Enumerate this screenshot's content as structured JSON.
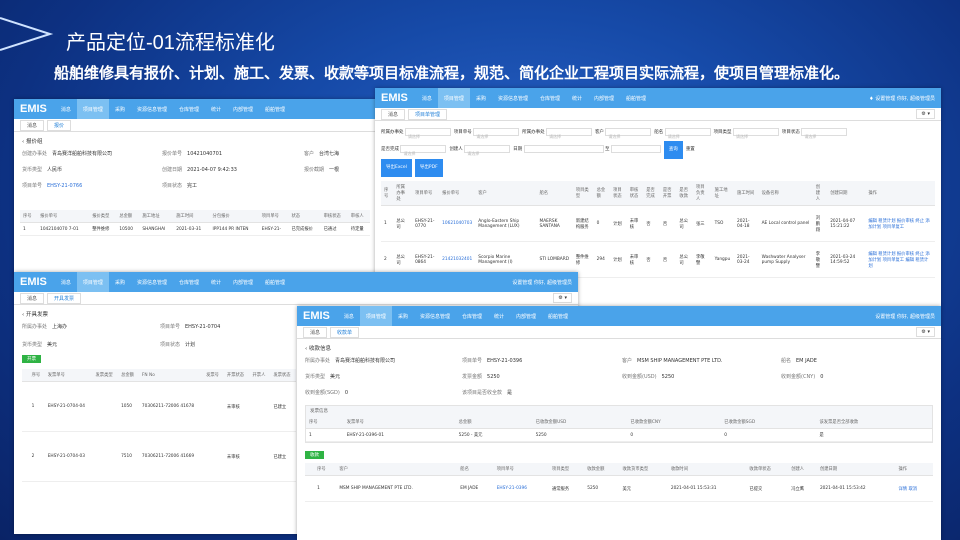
{
  "slide": {
    "title": "产品定位-01流程标准化",
    "subtitle": "船舶维修具有报价、计划、施工、发票、收款等项目标准流程，规范、简化企业工程项目实际流程，使项目管理标准化。"
  },
  "app": {
    "logo": "EMIS",
    "menu": [
      "消息",
      "项目管理",
      "采购",
      "资源信息管理",
      "仓库管理",
      "统计",
      "内部管理",
      "船舶管理"
    ],
    "settings": "设置管理",
    "user": "你好, 超级管理员"
  },
  "win1": {
    "tabs": [
      "消息",
      "报价"
    ],
    "section": "报价组",
    "fields": [
      {
        "k": "创建办事处",
        "v": "青岛赛洋船舶科技有限公司"
      },
      {
        "k": "报价单号",
        "v": "10421040701"
      },
      {
        "k": "客户",
        "v": "台湾七海"
      },
      {
        "k": "货币类型",
        "v": "人民币"
      },
      {
        "k": "创建日期",
        "v": "2021-04-07 9:42:33"
      },
      {
        "k": "报价截期",
        "v": "一根"
      },
      {
        "k": "项目单号",
        "v": "EHSY-21-0766"
      },
      {
        "k": "项目状态",
        "v": "完工"
      }
    ],
    "headers": [
      "序号",
      "报价单号",
      "报价类型",
      "总金额",
      "施工地址",
      "施工时间",
      "分包报价",
      "项目单号",
      "状态",
      "审核状态",
      "审核人"
    ],
    "row": [
      "1",
      "1042104070 7-01",
      "整件维修",
      "10500",
      "SHANGHAI",
      "2021-03-31",
      "IPP144 PR INTEN",
      "EHSY-21-",
      "已完成报价",
      "已通过",
      "待定量"
    ]
  },
  "win2": {
    "tabs": [
      "消息",
      "项目单管理"
    ],
    "labels": {
      "office": "所属办事处",
      "project_no": "项目单号",
      "office2": "所属办事处",
      "customer": "客户",
      "ship": "船名",
      "ptype": "项目类型",
      "pstatus": "项目状态",
      "done": "是否完成",
      "creator": "创建人",
      "date": "日期",
      "to": "至"
    },
    "placeholder": "请选择",
    "search": "查询",
    "reset": "重置",
    "export_excel": "导出Excel",
    "export_pdf": "导出PDF",
    "headers": [
      "序号",
      "所属办事处",
      "项目单号",
      "报价单号",
      "客户",
      "船名",
      "项目类型",
      "总金额",
      "项目状态",
      "审核状态",
      "是否完成",
      "是否开票",
      "是否收款",
      "项目负责人",
      "施工地址",
      "施工时间",
      "设备名称",
      "创建人",
      "创建日期",
      "操作"
    ],
    "rows": [
      [
        "1",
        "总公司",
        "EHSY-21-0770",
        "10621040703",
        "Anglo-Eastern Ship Management (LUX)",
        "MAERSK SANTANA",
        "新建结构服务",
        "0",
        "计划",
        "未审核",
        "否",
        "否",
        "总公司",
        "张三",
        "TSO",
        "2021-04-18",
        "AE Local control panel",
        "刘鹏翔",
        "2021-04-07 15:21:22",
        "编辑 租赁计划 报价审核 终止 添加计划 项目单复工"
      ],
      [
        "2",
        "总公司",
        "EHSY-21-0864",
        "21421032401",
        "Scorpio Marine Management (I)",
        "STI LOMBARD",
        "整件维修",
        "294",
        "计划",
        "未审核",
        "否",
        "否",
        "总公司",
        "李敬譬",
        "Yangpu",
        "2021-03-24",
        "Washwater Analyser pump Supply",
        "李敬譬",
        "2021-03-24 14:59:52",
        "编辑 租赁计划 报价审核 终止 添加计划 项目单复工 编辑 租赁计划"
      ]
    ]
  },
  "win3": {
    "tabs": [
      "消息",
      "开具发票"
    ],
    "section": "开具发票",
    "fields": [
      {
        "k": "所属办事处",
        "v": "上海办"
      },
      {
        "k": "项目单号",
        "v": "EHSY-21-0704"
      },
      {
        "k": "货币类型",
        "v": "美元"
      },
      {
        "k": "项目状态",
        "v": "计划"
      }
    ],
    "open_btn": "开票",
    "headers": [
      "",
      "序号",
      "发票单号",
      "发票类型",
      "总金额",
      "FN No",
      "发票号",
      "开票状态",
      "开票人",
      "发票状态"
    ],
    "rows": [
      [
        "",
        "1",
        "EHSY-21-0704-04",
        "",
        "1050",
        "70306211-72006 41678",
        "",
        "未审核",
        "",
        "已建立"
      ],
      [
        "",
        "2",
        "EHSY-21-0704-03",
        "",
        "7510",
        "70306211-72006 41669",
        "",
        "未审核",
        "",
        "已建立"
      ]
    ]
  },
  "win4": {
    "tabs": [
      "消息",
      "收款单"
    ],
    "section": "收款信息",
    "fields": [
      {
        "k": "所属办事处",
        "v": "青岛赛洋船舶科技有限公司"
      },
      {
        "k": "项目单号",
        "v": "EHSY-21-0396"
      },
      {
        "k": "客户",
        "v": "MSM SHIP MANAGEMENT PTE LTD."
      },
      {
        "k": "船名",
        "v": "EM JADE"
      },
      {
        "k": "货币类型",
        "v": "美元"
      },
      {
        "k": "发票金额",
        "v": "5250"
      },
      {
        "k": "收到金额(USD)",
        "v": "5250"
      },
      {
        "k": "收到金额(CNY)",
        "v": "0"
      },
      {
        "k": "收到金额(SGD)",
        "v": "0"
      },
      {
        "k": "该项目是否收全款",
        "v": "是"
      }
    ],
    "invoice_group": "发票信息",
    "inv_headers": [
      "序号",
      "发票单号",
      "总金额",
      "已收款金额USD",
      "已收款金额CNY",
      "已收款金额SGD",
      "该发票是否全部收款"
    ],
    "inv_row": [
      "1",
      "EHSY-21-0396-01",
      "5250 - 美元",
      "5250",
      "0",
      "0",
      "是"
    ],
    "collect_btn": "收款",
    "rec_headers": [
      "",
      "序号",
      "客户",
      "船名",
      "项目单号",
      "项目类型",
      "收款金额",
      "收款货币类型",
      "收款时间",
      "收款单状态",
      "创建人",
      "创建日期",
      "操作"
    ],
    "rec_row": [
      "",
      "1",
      "MSM SHIP MANAGEMENT PTE LTD.",
      "EM JADE",
      "EHSY-21-0396",
      "通常服务",
      "5250",
      "美元",
      "2021-04-01 15:53:31",
      "已提交",
      "冯立鹰",
      "2021-04-01 15:53:42",
      "详情 取消"
    ]
  },
  "colors": {
    "nav": "#4aa3ea",
    "green": "#2fb344",
    "blue": "#2e8cf0",
    "bg": "#164aa8"
  }
}
